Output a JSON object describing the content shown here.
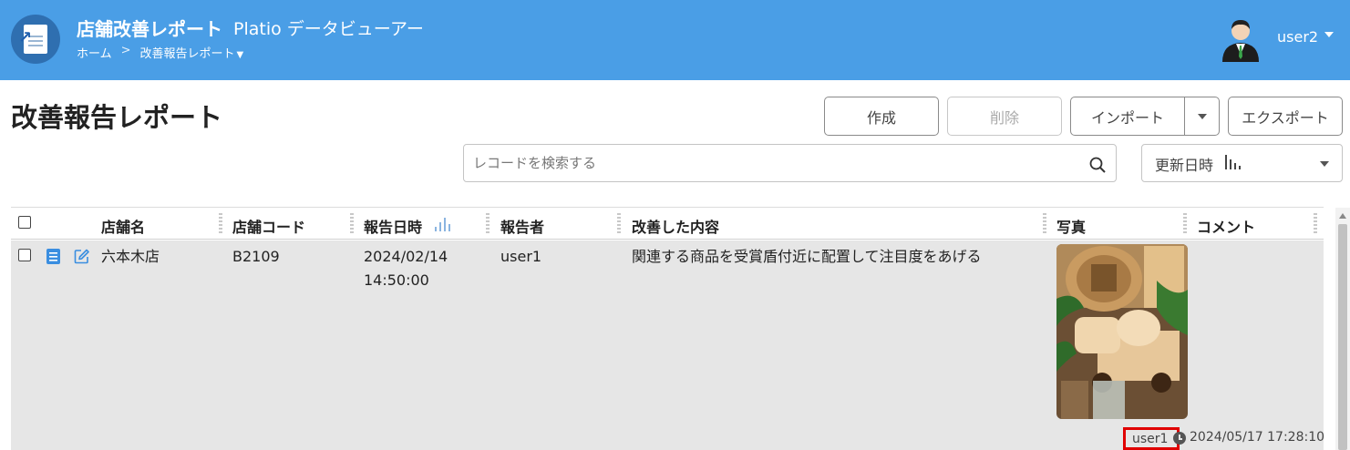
{
  "header": {
    "app_title": "店舗改善レポート",
    "app_subtitle": "Platio データビューアー",
    "breadcrumb": {
      "home": "ホーム",
      "separator": ">",
      "current": "改善報告レポート"
    },
    "user": {
      "name": "user2"
    },
    "colors": {
      "bar": "#4a9ee6"
    }
  },
  "page": {
    "title": "改善報告レポート"
  },
  "toolbar": {
    "create": "作成",
    "delete": "削除",
    "import": "インポート",
    "export": "エクスポート",
    "search_placeholder": "レコードを検索する",
    "sort_label": "更新日時"
  },
  "table": {
    "columns": [
      "店舗名",
      "店舗コード",
      "報告日時",
      "報告者",
      "改善した内容",
      "写真",
      "コメント"
    ],
    "rows": [
      {
        "store_name": "六本木店",
        "store_code": "B2109",
        "report_date": "2024/02/14",
        "report_time": "14:50:00",
        "reporter": "user1",
        "improvement": "関連する商品を受賞盾付近に配置して注目度をあげる",
        "comment": "",
        "updated_by": "user1",
        "updated_at": "2024/05/17 17:28:10"
      }
    ]
  }
}
